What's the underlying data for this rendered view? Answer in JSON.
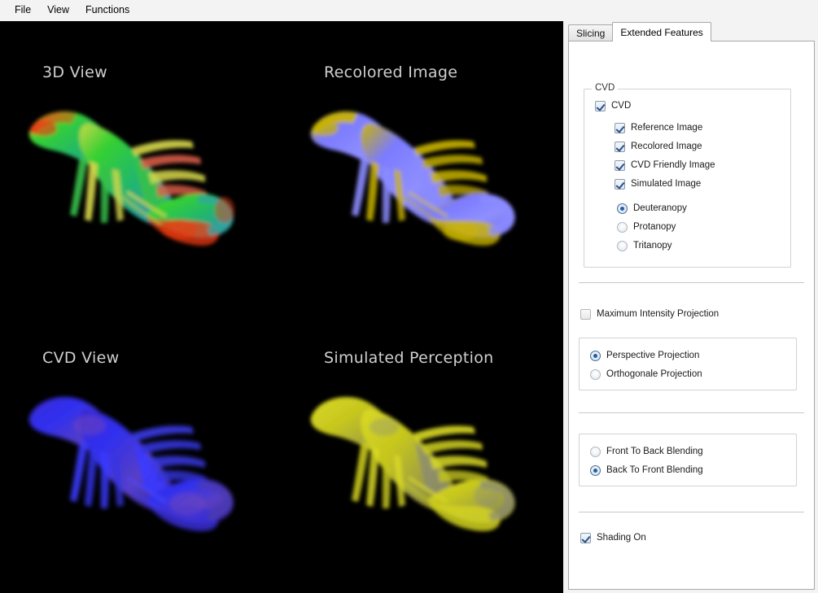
{
  "menubar": {
    "items": [
      {
        "label": "File"
      },
      {
        "label": "View"
      },
      {
        "label": "Functions"
      }
    ]
  },
  "viewport": {
    "background_color": "#000000",
    "panels": [
      {
        "id": "3d-view",
        "title": "3D View",
        "description": "Volume rendered crayfish, original colors",
        "colors": [
          "#22cc22",
          "#e03c18",
          "#2fa5a0",
          "#d8d84a"
        ]
      },
      {
        "id": "recolored-image",
        "title": "Recolored Image",
        "description": "Volume rendered crayfish, CVD friendly recoloring",
        "colors": [
          "#6b6bff",
          "#c8b400",
          "#9a9aff",
          "#8f8300"
        ]
      },
      {
        "id": "cvd-view",
        "title": "CVD View",
        "description": "Volume rendered crayfish as perceived with deuteranopy",
        "colors": [
          "#2a2ae6",
          "#5b3fb0",
          "#7b4fa8",
          "#1a1a9a"
        ]
      },
      {
        "id": "simulated-perception",
        "title": "Simulated Perception",
        "description": "Volume rendered crayfish, simulated perception of recolored image",
        "colors": [
          "#d0d020",
          "#9a9a18",
          "#7f7f66",
          "#bcbc3a"
        ]
      }
    ]
  },
  "rightpanel": {
    "tabs": [
      {
        "label": "Slicing",
        "active": false
      },
      {
        "label": "Extended Features",
        "active": true
      }
    ],
    "cvd_group": {
      "title": "CVD",
      "master_checkbox": {
        "label": "CVD",
        "checked": true
      },
      "checkboxes": [
        {
          "label": "Reference Image",
          "checked": true
        },
        {
          "label": "Recolored Image",
          "checked": true
        },
        {
          "label": "CVD Friendly Image",
          "checked": true
        },
        {
          "label": "Simulated Image",
          "checked": true
        }
      ],
      "radios": [
        {
          "label": "Deuteranopy",
          "selected": true
        },
        {
          "label": "Protanopy",
          "selected": false
        },
        {
          "label": "Tritanopy",
          "selected": false
        }
      ]
    },
    "mip_checkbox": {
      "label": "Maximum Intensity Projection",
      "checked": false
    },
    "projection_group": {
      "radios": [
        {
          "label": "Perspective Projection",
          "selected": true
        },
        {
          "label": "Orthogonale Projection",
          "selected": false
        }
      ]
    },
    "blending_group": {
      "radios": [
        {
          "label": "Front To Back Blending",
          "selected": false
        },
        {
          "label": "Back To Front Blending",
          "selected": true
        }
      ]
    },
    "shading_checkbox": {
      "label": "Shading On",
      "checked": true
    }
  }
}
